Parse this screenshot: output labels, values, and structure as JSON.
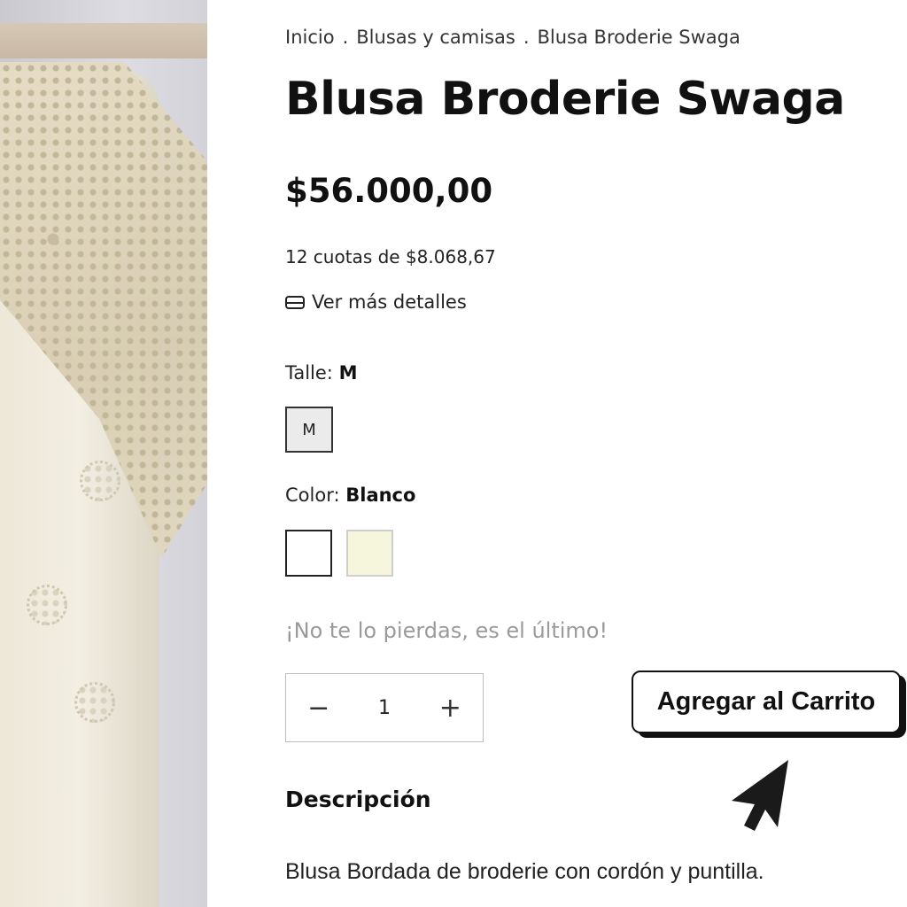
{
  "breadcrumb": {
    "items": [
      "Inicio",
      "Blusas y camisas",
      "Blusa Broderie Swaga"
    ],
    "separator": "."
  },
  "product": {
    "title": "Blusa Broderie Swaga",
    "price": "$56.000,00",
    "installments": "12 cuotas de $8.068,67",
    "details_link": "Ver más detalles",
    "details_icon": "credit-card-icon"
  },
  "size": {
    "label": "Talle:",
    "selected": "M",
    "options": [
      "M"
    ]
  },
  "color": {
    "label": "Color:",
    "selected": "Blanco",
    "swatches": [
      {
        "name": "Blanco",
        "hex": "#ffffff"
      },
      {
        "name": "crema",
        "hex": "#f6f6dc"
      }
    ]
  },
  "stock_note": "¡No te lo pierdas, es el último!",
  "quantity": {
    "minus": "−",
    "value": "1",
    "plus": "+"
  },
  "cart": {
    "button_label": "Agregar al Carrito"
  },
  "description": {
    "heading": "Descripción",
    "text": "Blusa Bordada de broderie con cordón y puntilla."
  },
  "colors": {
    "text": "#111111",
    "muted": "#9a9a9a",
    "size_selected_bg": "#ebebeb"
  }
}
